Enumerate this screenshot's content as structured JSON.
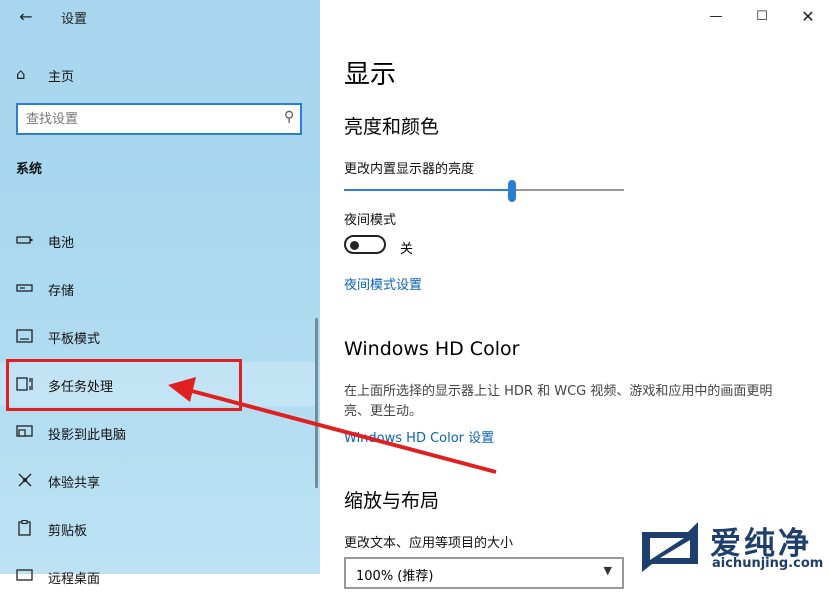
{
  "window": {
    "title": "设置",
    "back_icon": "back-arrow-icon",
    "minimize_icon": "minimize-icon",
    "maximize_icon": "maximize-icon",
    "close_icon": "close-icon"
  },
  "sidebar": {
    "home_label": "主页",
    "search_placeholder": "查找设置",
    "section_title": "系统",
    "items": [
      {
        "label": "电池",
        "icon": "battery-icon",
        "selected": false
      },
      {
        "label": "存储",
        "icon": "storage-icon",
        "selected": false
      },
      {
        "label": "平板模式",
        "icon": "tablet-mode-icon",
        "selected": false
      },
      {
        "label": "多任务处理",
        "icon": "multitasking-icon",
        "selected": true
      },
      {
        "label": "投影到此电脑",
        "icon": "project-icon",
        "selected": false
      },
      {
        "label": "体验共享",
        "icon": "shared-experiences-icon",
        "selected": false
      },
      {
        "label": "剪贴板",
        "icon": "clipboard-icon",
        "selected": false
      },
      {
        "label": "远程桌面",
        "icon": "remote-desktop-icon",
        "selected": false
      }
    ]
  },
  "main": {
    "title": "显示",
    "brightness": {
      "heading": "亮度和颜色",
      "slider_label": "更改内置显示器的亮度",
      "slider_value": 0.6
    },
    "night_light": {
      "label": "夜间模式",
      "state": "关",
      "settings_link": "夜间模式设置"
    },
    "hdr": {
      "heading": "Windows HD Color",
      "description": "在上面所选择的显示器上让 HDR 和 WCG 视频、游戏和应用中的画面更明亮、更生动。",
      "link": "Windows HD Color 设置"
    },
    "scale": {
      "heading": "缩放与布局",
      "label": "更改文本、应用等项目的大小",
      "dropdown_value": "100% (推荐)"
    }
  },
  "annotation": {
    "color": "#e02020"
  },
  "watermark": {
    "title": "爱纯净",
    "url": "aichunjing.com"
  },
  "colors": {
    "accent": "#2a7fd1",
    "link": "#0a63b9",
    "sidebar_bg": "#a9d8ef"
  }
}
